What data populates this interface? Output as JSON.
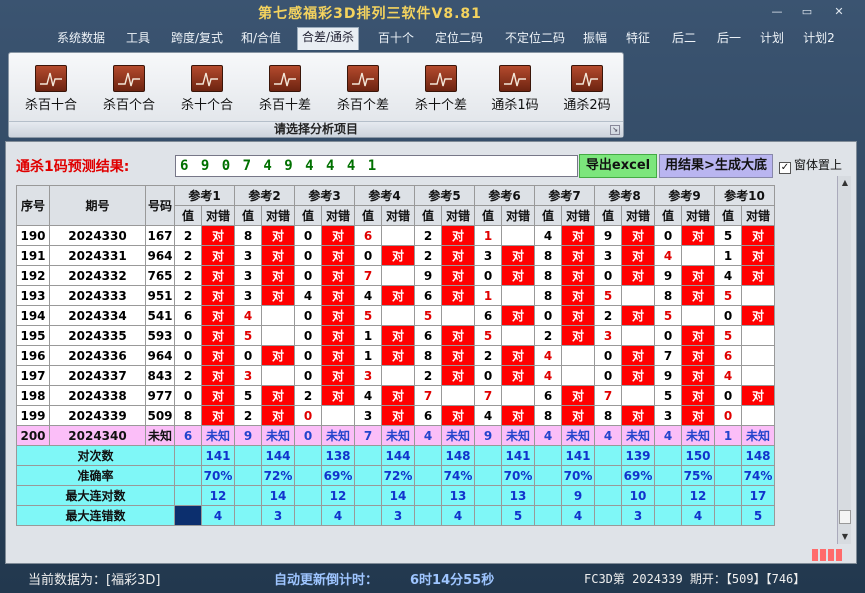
{
  "title": "第七感福彩3D排列三软件V8.81",
  "window_buttons": {
    "minimize": "—",
    "restore": "▭",
    "close": "✕"
  },
  "menu": [
    "系统数据",
    "工具",
    "跨度/复式",
    "和/合值",
    "合差/通杀",
    "百十个",
    "定位二码",
    "不定位二码",
    "振幅",
    "特征",
    "后二",
    "后一",
    "计划",
    "计划2"
  ],
  "active_menu": "合差/通杀",
  "ribbon": {
    "buttons": [
      "杀百十合",
      "杀百个合",
      "杀十个合",
      "杀百十差",
      "杀百个差",
      "杀十个差",
      "通杀1码",
      "通杀2码"
    ],
    "caption": "请选择分析项目",
    "icon": "chart-icon"
  },
  "prediction": {
    "label": "通杀1码预测结果:",
    "digits": "6 9 0 7 4 9 4 4 4 1",
    "export_button": "导出excel",
    "generate_button": "用结果>生成大底",
    "checkbox_label": "窗体置上",
    "checkbox_checked": true
  },
  "table": {
    "head": {
      "seq": "序号",
      "period": "期号",
      "code": "号码"
    },
    "refs": [
      "参考1",
      "参考2",
      "参考3",
      "参考4",
      "参考5",
      "参考6",
      "参考7",
      "参考8",
      "参考9",
      "参考10"
    ],
    "sub": {
      "value": "值",
      "result": "对错"
    },
    "hit_text": "对",
    "rows": [
      {
        "seq": "190",
        "period": "2024330",
        "code": "167",
        "vals": [
          "2",
          "8",
          "0",
          "6",
          "2",
          "1",
          "4",
          "9",
          "0",
          "5"
        ],
        "hits": [
          1,
          1,
          1,
          0,
          1,
          0,
          1,
          1,
          1,
          1
        ],
        "red": [
          0,
          0,
          0,
          1,
          0,
          1,
          0,
          0,
          0,
          0
        ]
      },
      {
        "seq": "191",
        "period": "2024331",
        "code": "964",
        "vals": [
          "2",
          "3",
          "0",
          "0",
          "2",
          "3",
          "8",
          "3",
          "4",
          "1"
        ],
        "hits": [
          1,
          1,
          1,
          1,
          1,
          1,
          1,
          1,
          0,
          1
        ],
        "red": [
          0,
          0,
          0,
          0,
          0,
          0,
          0,
          0,
          1,
          0
        ]
      },
      {
        "seq": "192",
        "period": "2024332",
        "code": "765",
        "vals": [
          "2",
          "3",
          "0",
          "7",
          "9",
          "0",
          "8",
          "0",
          "9",
          "4"
        ],
        "hits": [
          1,
          1,
          1,
          0,
          1,
          1,
          1,
          1,
          1,
          1
        ],
        "red": [
          0,
          0,
          0,
          1,
          0,
          0,
          0,
          0,
          0,
          0
        ]
      },
      {
        "seq": "193",
        "period": "2024333",
        "code": "951",
        "vals": [
          "2",
          "3",
          "4",
          "4",
          "6",
          "1",
          "8",
          "5",
          "8",
          "5"
        ],
        "hits": [
          1,
          1,
          1,
          1,
          1,
          0,
          1,
          0,
          1,
          0
        ],
        "red": [
          0,
          0,
          0,
          0,
          0,
          1,
          0,
          1,
          0,
          1
        ]
      },
      {
        "seq": "194",
        "period": "2024334",
        "code": "541",
        "vals": [
          "6",
          "4",
          "0",
          "5",
          "5",
          "6",
          "0",
          "2",
          "5",
          "0"
        ],
        "hits": [
          1,
          0,
          1,
          0,
          0,
          1,
          1,
          1,
          0,
          1
        ],
        "red": [
          0,
          1,
          0,
          1,
          1,
          0,
          0,
          0,
          1,
          0
        ]
      },
      {
        "seq": "195",
        "period": "2024335",
        "code": "593",
        "vals": [
          "0",
          "5",
          "0",
          "1",
          "6",
          "5",
          "2",
          "3",
          "0",
          "5"
        ],
        "hits": [
          1,
          0,
          1,
          1,
          1,
          0,
          1,
          0,
          1,
          0
        ],
        "red": [
          0,
          1,
          0,
          0,
          0,
          1,
          0,
          1,
          0,
          1
        ]
      },
      {
        "seq": "196",
        "period": "2024336",
        "code": "964",
        "vals": [
          "0",
          "0",
          "0",
          "1",
          "8",
          "2",
          "4",
          "0",
          "7",
          "6"
        ],
        "hits": [
          1,
          1,
          1,
          1,
          1,
          1,
          0,
          1,
          1,
          0
        ],
        "red": [
          0,
          0,
          0,
          0,
          0,
          0,
          1,
          0,
          0,
          1
        ]
      },
      {
        "seq": "197",
        "period": "2024337",
        "code": "843",
        "vals": [
          "2",
          "3",
          "0",
          "3",
          "2",
          "0",
          "4",
          "0",
          "9",
          "4"
        ],
        "hits": [
          1,
          0,
          1,
          0,
          1,
          1,
          0,
          1,
          1,
          0
        ],
        "red": [
          0,
          1,
          0,
          1,
          0,
          0,
          1,
          0,
          0,
          1
        ]
      },
      {
        "seq": "198",
        "period": "2024338",
        "code": "977",
        "vals": [
          "0",
          "5",
          "2",
          "4",
          "7",
          "7",
          "6",
          "7",
          "5",
          "0"
        ],
        "hits": [
          1,
          1,
          1,
          1,
          0,
          0,
          1,
          0,
          1,
          1
        ],
        "red": [
          0,
          0,
          0,
          0,
          1,
          1,
          0,
          1,
          0,
          0
        ]
      },
      {
        "seq": "199",
        "period": "2024339",
        "code": "509",
        "vals": [
          "8",
          "2",
          "0",
          "3",
          "6",
          "4",
          "8",
          "8",
          "3",
          "0"
        ],
        "hits": [
          1,
          1,
          0,
          1,
          1,
          1,
          1,
          1,
          1,
          0
        ],
        "red": [
          0,
          0,
          1,
          0,
          0,
          0,
          0,
          0,
          0,
          1
        ]
      }
    ],
    "predict_row": {
      "seq": "200",
      "period": "2024340",
      "code": "未知",
      "vals": [
        "6",
        "9",
        "0",
        "7",
        "4",
        "9",
        "4",
        "4",
        "4",
        "1"
      ],
      "result": "未知"
    },
    "stats": [
      {
        "label": "对次数",
        "vals": [
          "141",
          "144",
          "138",
          "144",
          "148",
          "141",
          "141",
          "139",
          "150",
          "148"
        ]
      },
      {
        "label": "准确率",
        "vals": [
          "70%",
          "72%",
          "69%",
          "72%",
          "74%",
          "70%",
          "70%",
          "69%",
          "75%",
          "74%"
        ]
      },
      {
        "label": "最大连对数",
        "vals": [
          "12",
          "14",
          "12",
          "14",
          "13",
          "13",
          "9",
          "10",
          "12",
          "17"
        ]
      },
      {
        "label": "最大连错数",
        "vals": [
          "4",
          "3",
          "4",
          "3",
          "4",
          "5",
          "4",
          "3",
          "4",
          "5"
        ]
      }
    ]
  },
  "status": {
    "current_data": "当前数据为：[福彩3D]",
    "auto_update": "自动更新倒计时：",
    "countdown": "6时14分55秒",
    "draw_info": "FC3D第 2024339 期开：【509】【746】"
  }
}
